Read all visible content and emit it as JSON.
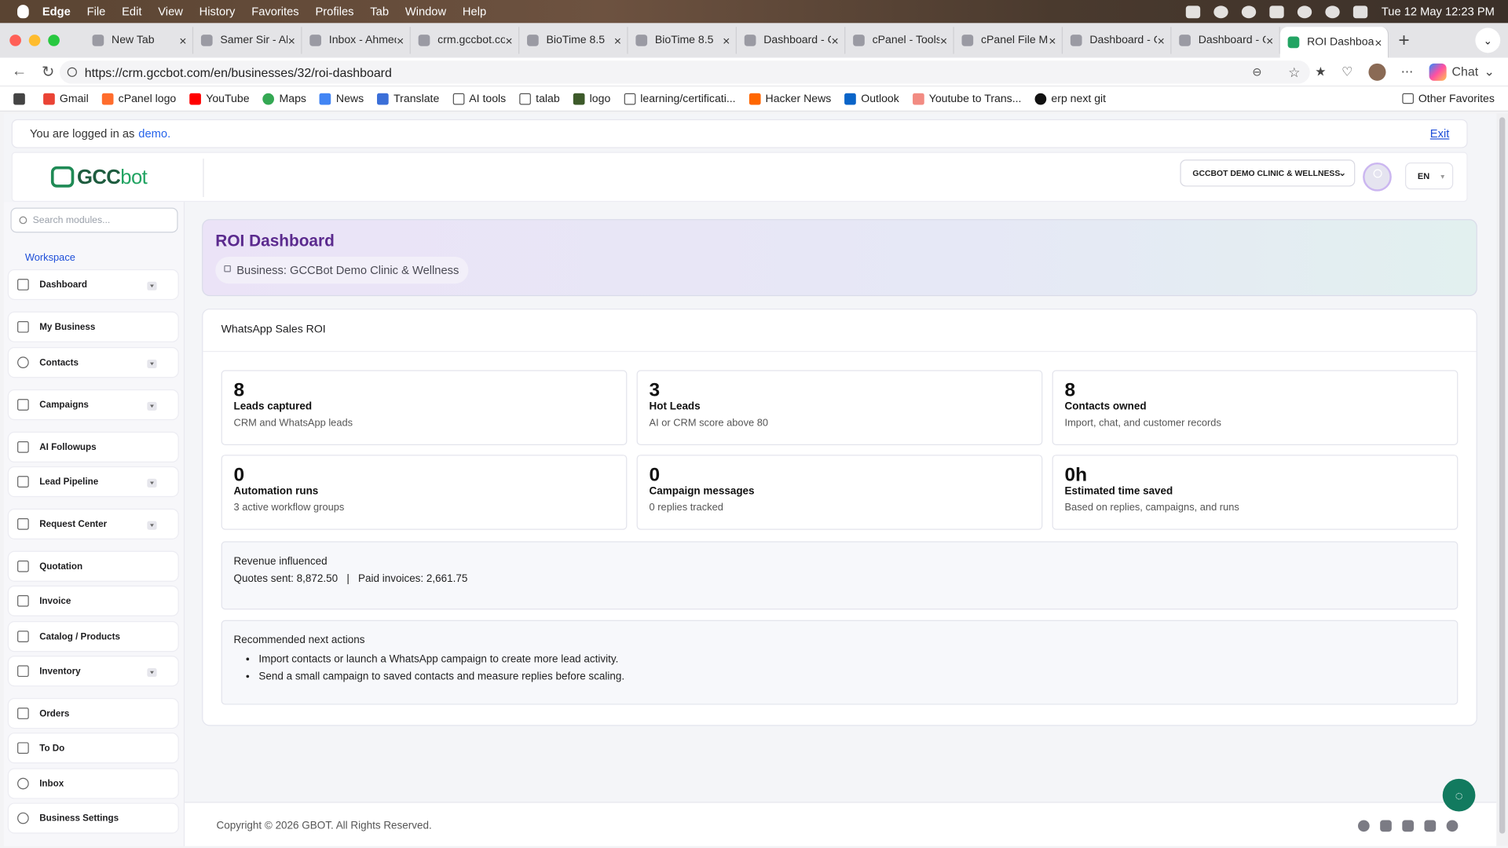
{
  "menubar": {
    "app": "Edge",
    "items": [
      "File",
      "Edit",
      "View",
      "History",
      "Favorites",
      "Profiles",
      "Tab",
      "Window",
      "Help"
    ],
    "datetime": "Tue 12 May  12:23 PM"
  },
  "tabs": [
    {
      "title": "New Tab"
    },
    {
      "title": "Samer Sir - Ah"
    },
    {
      "title": "Inbox - Ahmed"
    },
    {
      "title": "crm.gccbot.co"
    },
    {
      "title": "BioTime 8.5"
    },
    {
      "title": "BioTime 8.5"
    },
    {
      "title": "Dashboard - G"
    },
    {
      "title": "cPanel - Tools"
    },
    {
      "title": "cPanel File Ma"
    },
    {
      "title": "Dashboard - G"
    },
    {
      "title": "Dashboard - G"
    },
    {
      "title": "ROI Dashboard"
    }
  ],
  "address": {
    "url": "https://crm.gccbot.com/en/businesses/32/roi-dashboard"
  },
  "toolbar": {
    "chat_label": "Chat"
  },
  "bookmarks": [
    "Gmail",
    "cPanel logo",
    "YouTube",
    "Maps",
    "News",
    "Translate",
    "AI tools",
    "talab",
    "logo",
    "learning/certificati...",
    "Hacker News",
    "Outlook",
    "Youtube to Trans...",
    "erp next git"
  ],
  "other_favorites": "Other Favorites",
  "login": {
    "prefix": "You are logged in as",
    "user": "demo.",
    "exit": "Exit"
  },
  "brand": {
    "logo_text": "GCC",
    "logo_suffix": "bot"
  },
  "header": {
    "business_select": "GCCBOT DEMO CLINIC & WELLNESS",
    "language": "EN"
  },
  "sidebar": {
    "search_placeholder": "Search modules...",
    "section": "Workspace",
    "items": [
      {
        "label": "Dashboard",
        "chevron": true
      },
      {
        "label": "My Business",
        "chevron": false
      },
      {
        "label": "Contacts",
        "chevron": true
      },
      {
        "label": "Campaigns",
        "chevron": true
      },
      {
        "label": "AI Followups",
        "chevron": false
      },
      {
        "label": "Lead Pipeline",
        "chevron": true
      },
      {
        "label": "Request Center",
        "chevron": true
      },
      {
        "label": "Quotation",
        "chevron": false
      },
      {
        "label": "Invoice",
        "chevron": false
      },
      {
        "label": "Catalog / Products",
        "chevron": false
      },
      {
        "label": "Inventory",
        "chevron": true
      },
      {
        "label": "Orders",
        "chevron": false
      },
      {
        "label": "To Do",
        "chevron": false
      },
      {
        "label": "Inbox",
        "chevron": false
      },
      {
        "label": "Business Settings",
        "chevron": false
      }
    ]
  },
  "hero": {
    "title": "ROI Dashboard",
    "business": "Business: GCCBot Demo Clinic & Wellness"
  },
  "roi": {
    "title": "WhatsApp Sales ROI",
    "metrics": [
      {
        "value": "8",
        "label": "Leads captured",
        "desc": "CRM and WhatsApp leads"
      },
      {
        "value": "3",
        "label": "Hot Leads",
        "desc": "AI or CRM score above 80"
      },
      {
        "value": "8",
        "label": "Contacts owned",
        "desc": "Import, chat, and customer records"
      },
      {
        "value": "0",
        "label": "Automation runs",
        "desc": "3 active workflow groups"
      },
      {
        "value": "0",
        "label": "Campaign messages",
        "desc": "0 replies tracked"
      },
      {
        "value": "0h",
        "label": "Estimated time saved",
        "desc": "Based on replies, campaigns, and runs"
      }
    ],
    "revenue": {
      "title": "Revenue influenced",
      "line": "Quotes sent: 8,872.50   |   Paid invoices: 2,661.75"
    },
    "recommendations": {
      "title": "Recommended next actions",
      "items": [
        "Import contacts or launch a WhatsApp campaign to create more lead activity.",
        "Send a small campaign to saved contacts and measure replies before scaling."
      ]
    }
  },
  "footer": {
    "copyright": "Copyright © 2026 GBOT. All Rights Reserved."
  },
  "colors": {
    "accent": "#5b2a8e",
    "link": "#1d4ed8",
    "brand_green": "#1f8a55",
    "fab": "#127a5f"
  }
}
